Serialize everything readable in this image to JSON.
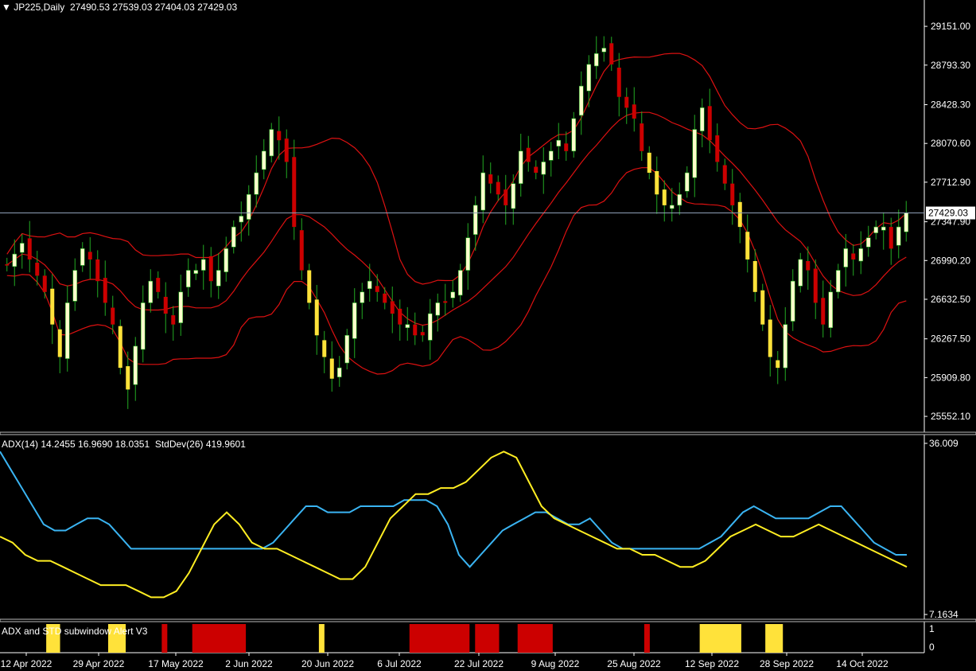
{
  "header": {
    "symbol": "JP225,Daily",
    "ohlc": "27490.53 27539.03 27404.03 27429.03",
    "adx_label": "ADX(14) 14.2455 16.9690 18.0351  StdDev(26) 419.9601",
    "alert_label": "ADX and STD subwindow Alert V3"
  },
  "colors": {
    "background": "#000000",
    "bull_candle": "#ffffcc",
    "bear_candle": "#cc0000",
    "alert_candle": "#ffe23a",
    "wick": "#22aa22",
    "envelope": "#dd1111",
    "price_line": "#8fa0b8",
    "adx_line": "#3ab4f2",
    "std_line": "#ffee22",
    "alert_yellow": "#ffe23a",
    "alert_red": "#cc0000"
  },
  "chart_data": [
    {
      "type": "candlestick",
      "title": "JP225,Daily",
      "y_ticks": [
        "29151.00",
        "28793.30",
        "28428.30",
        "28070.60",
        "27712.90",
        "27347.90",
        "26990.20",
        "26632.50",
        "26267.50",
        "25909.80",
        "25552.10"
      ],
      "y_tick_values": [
        29151.0,
        28793.3,
        28428.3,
        28070.6,
        27712.9,
        27347.9,
        26990.2,
        26632.5,
        26267.5,
        25909.8,
        25552.1
      ],
      "current_price": "27429.03",
      "x_ticks": [
        "12 Apr 2022",
        "29 Apr 2022",
        "17 May 2022",
        "2 Jun 2022",
        "20 Jun 2022",
        "6 Jul 2022",
        "22 Jul 2022",
        "9 Aug 2022",
        "25 Aug 2022",
        "12 Sep 2022",
        "28 Sep 2022",
        "14 Oct 2022"
      ],
      "ylim": [
        25450,
        29350
      ],
      "close_series": [
        26950,
        27050,
        27150,
        27000,
        26850,
        26700,
        26400,
        26100,
        26600,
        26900,
        27100,
        27000,
        26800,
        26600,
        26400,
        26000,
        25800,
        26200,
        26600,
        26800,
        26700,
        26500,
        26400,
        26700,
        26900,
        26900,
        27000,
        26800,
        26900,
        27100,
        27300,
        27400,
        27600,
        27800,
        28000,
        28200,
        28100,
        27900,
        27300,
        26900,
        26600,
        26300,
        26100,
        25900,
        26000,
        26300,
        26600,
        26700,
        26800,
        26700,
        26600,
        26500,
        26400,
        26400,
        26300,
        26300,
        26500,
        26600,
        26600,
        26700,
        26900,
        27200,
        27500,
        27800,
        27700,
        27600,
        27500,
        27700,
        28000,
        27900,
        27800,
        27900,
        28000,
        28100,
        28000,
        28300,
        28600,
        28800,
        28900,
        28950,
        28800,
        28500,
        28400,
        28300,
        28000,
        27800,
        27600,
        27500,
        27500,
        27600,
        27800,
        28200,
        28400,
        28100,
        27900,
        27700,
        27500,
        27300,
        27000,
        26700,
        26400,
        26100,
        26000,
        26400,
        26800,
        27000,
        26900,
        26600,
        26400,
        26700,
        26900,
        27100,
        27000,
        27100,
        27200,
        27300,
        27300,
        27100,
        27300,
        27430
      ]
    },
    {
      "type": "line",
      "title": "ADX(14) 14.2455 16.9690 18.0351  StdDev(26) 419.9601",
      "y_ticks": [
        "36.009",
        "7.1634"
      ],
      "ylim": [
        7.1634,
        36.009
      ],
      "series": [
        {
          "name": "ADX",
          "values": [
            34,
            31,
            28,
            25,
            22,
            21,
            21,
            22,
            23,
            23,
            22,
            20,
            18,
            18,
            18,
            18,
            18,
            18,
            18,
            18,
            18,
            18,
            18,
            18,
            18,
            19,
            21,
            23,
            25,
            25,
            24,
            24,
            24,
            25,
            25,
            25,
            25,
            26,
            26,
            26,
            25,
            22,
            17,
            15,
            17,
            19,
            21,
            22,
            23,
            24,
            24,
            23,
            22,
            22,
            23,
            21,
            19,
            18,
            18,
            18,
            18,
            18,
            18,
            18,
            18,
            19,
            20,
            22,
            24,
            25,
            24,
            23,
            23,
            23,
            23,
            24,
            25,
            25,
            23,
            21,
            19,
            18,
            17,
            17
          ]
        },
        {
          "name": "StdDev",
          "values": [
            20,
            19,
            17,
            16,
            16,
            15,
            14,
            13,
            12,
            12,
            12,
            11,
            10,
            10,
            11,
            14,
            18,
            22,
            24,
            22,
            19,
            18,
            18,
            17,
            16,
            15,
            14,
            13,
            13,
            15,
            19,
            23,
            25,
            27,
            27,
            28,
            28,
            29,
            31,
            33,
            34,
            33,
            29,
            25,
            23,
            22,
            21,
            20,
            19,
            18,
            18,
            17,
            17,
            16,
            15,
            15,
            16,
            18,
            20,
            21,
            22,
            21,
            20,
            20,
            21,
            22,
            21,
            20,
            19,
            18,
            17,
            16,
            15
          ]
        }
      ]
    },
    {
      "type": "heatmap",
      "title": "ADX and STD subwindow Alert V3",
      "y_ticks": [
        "1",
        "0"
      ],
      "segments": [
        {
          "color": "yellow",
          "start": 0.05,
          "end": 0.065
        },
        {
          "color": "yellow",
          "start": 0.117,
          "end": 0.136
        },
        {
          "color": "red",
          "start": 0.175,
          "end": 0.181
        },
        {
          "color": "red",
          "start": 0.208,
          "end": 0.266
        },
        {
          "color": "yellow",
          "start": 0.345,
          "end": 0.351
        },
        {
          "color": "red",
          "start": 0.443,
          "end": 0.508
        },
        {
          "color": "red",
          "start": 0.514,
          "end": 0.54
        },
        {
          "color": "red",
          "start": 0.56,
          "end": 0.598
        },
        {
          "color": "red",
          "start": 0.697,
          "end": 0.703
        },
        {
          "color": "yellow",
          "start": 0.757,
          "end": 0.802
        },
        {
          "color": "yellow",
          "start": 0.828,
          "end": 0.847
        }
      ]
    }
  ]
}
